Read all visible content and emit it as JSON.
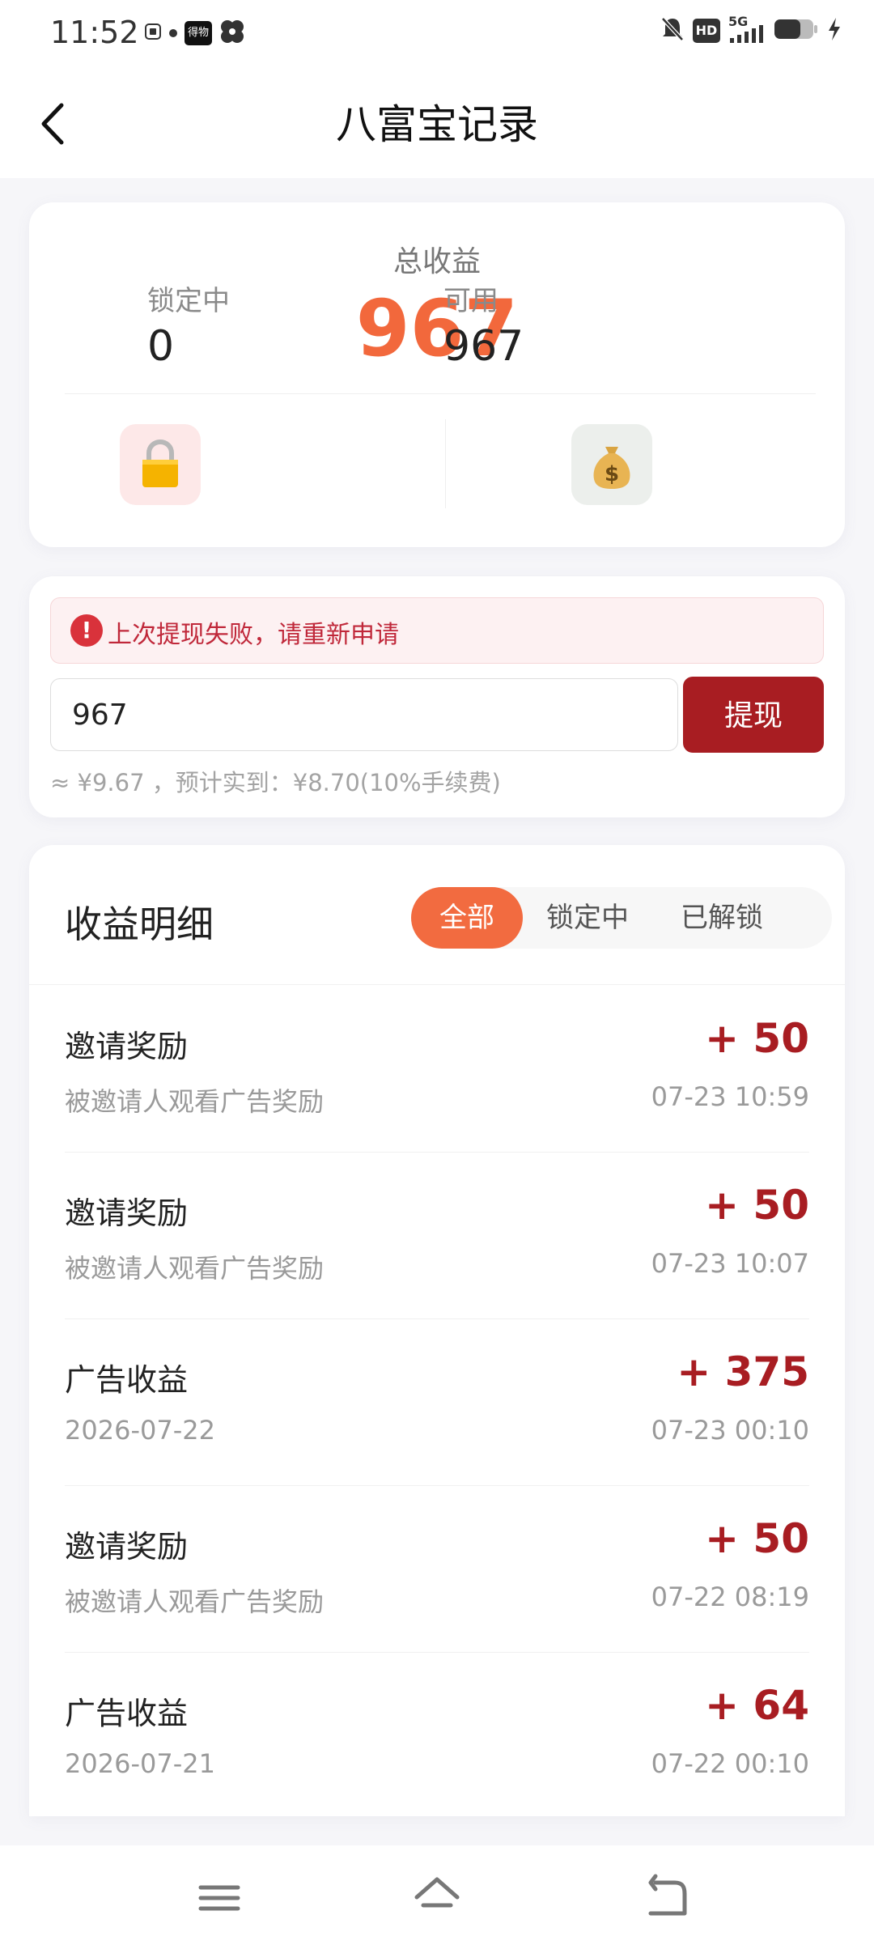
{
  "status_bar": {
    "time": "11:52",
    "left_icons": [
      "notification-icon",
      "dot-icon",
      "app-icon",
      "fan-icon"
    ],
    "app_chip_label": "得物",
    "network": "5G",
    "hd": "HD"
  },
  "header": {
    "title": "八富宝记录"
  },
  "summary": {
    "total_label": "总收益",
    "total_value": "967",
    "locked_label": "锁定中",
    "locked_value": "0",
    "available_label": "可用",
    "available_value": "967"
  },
  "withdraw": {
    "alert_text": "上次提现失败，请重新申请",
    "amount_value": "967",
    "button_label": "提现",
    "hint": "≈ ¥9.67 ，预计实到：¥8.70(10%手续费)"
  },
  "detail": {
    "title": "收益明细",
    "tabs": [
      {
        "label": "全部",
        "active": true
      },
      {
        "label": "锁定中",
        "active": false
      },
      {
        "label": "已解锁",
        "active": false
      }
    ],
    "rows": [
      {
        "title": "邀请奖励",
        "subtitle": "被邀请人观看广告奖励",
        "amount": "+ 50",
        "time": "07-23 10:59"
      },
      {
        "title": "邀请奖励",
        "subtitle": "被邀请人观看广告奖励",
        "amount": "+ 50",
        "time": "07-23 10:07"
      },
      {
        "title": "广告收益",
        "subtitle": "2026-07-22",
        "amount": "+ 375",
        "time": "07-23 00:10"
      },
      {
        "title": "邀请奖励",
        "subtitle": "被邀请人观看广告奖励",
        "amount": "+ 50",
        "time": "07-22 08:19"
      },
      {
        "title": "广告收益",
        "subtitle": "2026-07-21",
        "amount": "+ 64",
        "time": "07-22 00:10"
      }
    ]
  },
  "nav_bar": {
    "buttons": [
      "menu-icon",
      "home-icon",
      "back-nav-icon"
    ]
  },
  "colors": {
    "accent_orange": "#f2683c",
    "accent_red": "#a81d22",
    "alert_red": "#c0283a"
  }
}
